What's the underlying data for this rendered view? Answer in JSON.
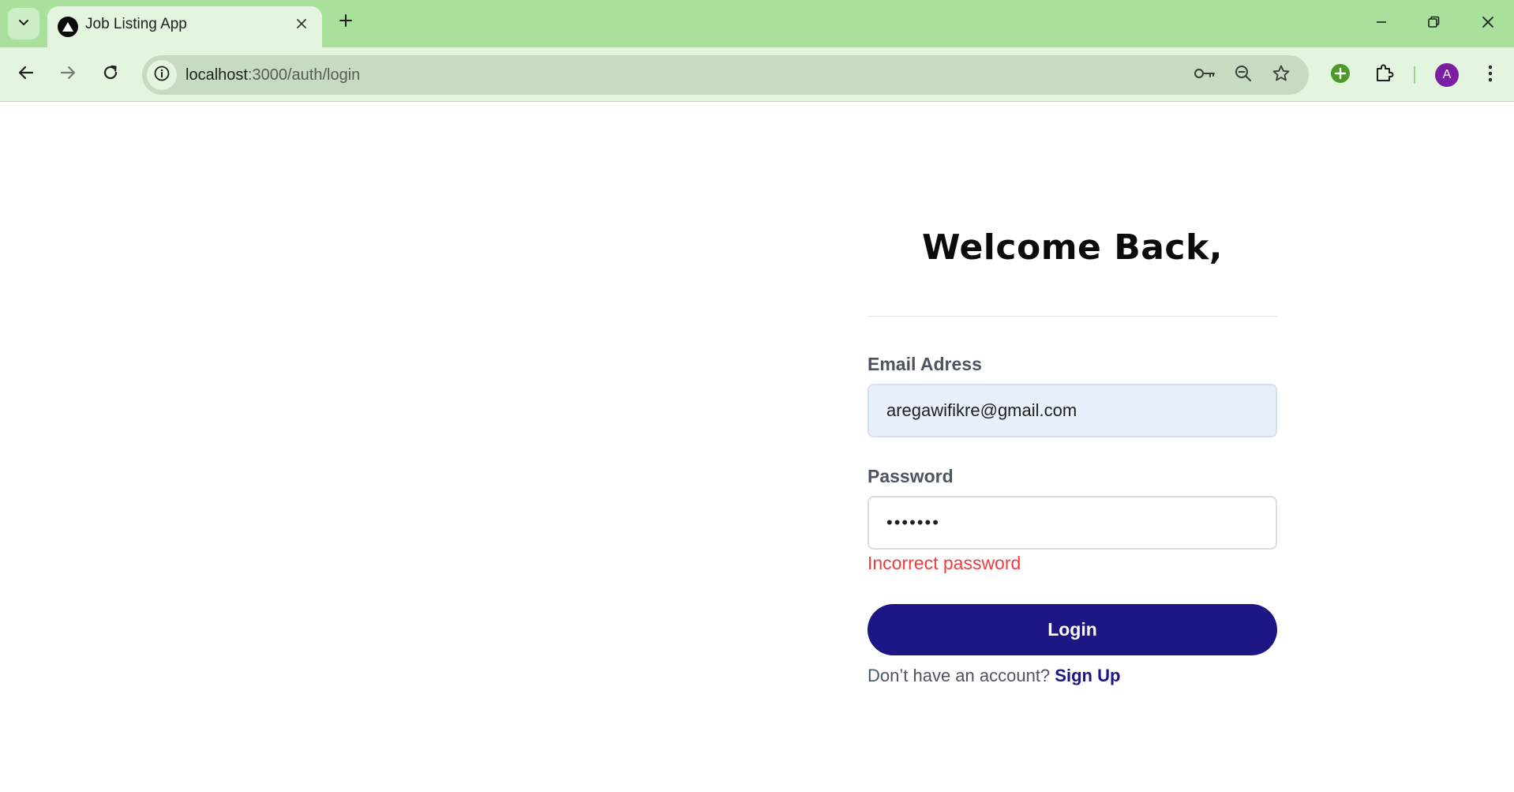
{
  "browser": {
    "tab": {
      "title": "Job Listing App"
    },
    "address_bar": {
      "host": "localhost",
      "path": ":3000/auth/login"
    },
    "profile_initial": "A",
    "colors": {
      "tabbar": "#a8e09c",
      "toolbar": "#e3f4df",
      "omnibox": "#c7dac2"
    }
  },
  "login_form": {
    "heading": "Welcome Back,",
    "email": {
      "label": "Email Adress",
      "value": "aregawifikre@gmail.com"
    },
    "password": {
      "label": "Password",
      "value": "•••••••"
    },
    "error": "Incorrect password",
    "submit_label": "Login",
    "signup_prompt": "Don’t have an account?",
    "signup_link": "Sign Up",
    "colors": {
      "primary": "#1c1784",
      "error": "#ef3d3d",
      "email_fill": "#e8f0fe"
    }
  }
}
